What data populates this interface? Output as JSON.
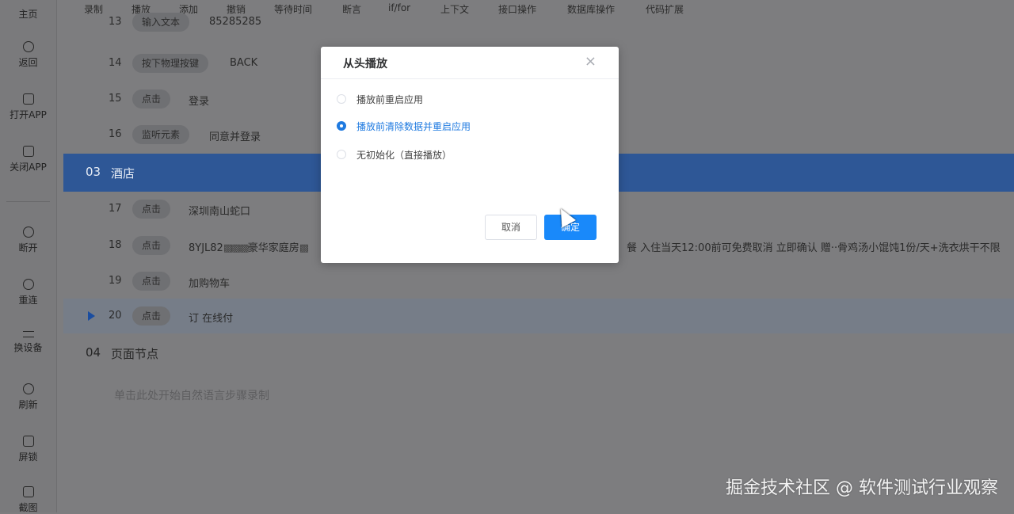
{
  "sidebar": {
    "items": [
      {
        "label": "主页",
        "icon": "home-icon"
      },
      {
        "label": "返回",
        "icon": "back-icon"
      },
      {
        "label": "打开APP",
        "icon": "open-app-icon"
      },
      {
        "label": "关闭APP",
        "icon": "close-app-icon"
      },
      {
        "label": "断开",
        "icon": "disconnect-icon"
      },
      {
        "label": "重连",
        "icon": "link-icon"
      },
      {
        "label": "换设备",
        "icon": "swap-icon"
      },
      {
        "label": "刷新",
        "icon": "refresh-icon"
      },
      {
        "label": "屏锁",
        "icon": "lock-icon"
      },
      {
        "label": "截图",
        "icon": "crop-icon"
      }
    ]
  },
  "toolbar": {
    "items": [
      "录制",
      "播放",
      "添加",
      "撤销",
      "等待时间",
      "断言",
      "if/for",
      "上下文",
      "接口操作",
      "数据库操作",
      "代码扩展"
    ]
  },
  "steps": {
    "row13": {
      "num": "13",
      "tag": "输入文本",
      "value": "85285285"
    },
    "row14": {
      "num": "14",
      "tag": "按下物理按键",
      "value": "BACK"
    },
    "row15": {
      "num": "15",
      "tag": "点击",
      "value": "登录"
    },
    "row16": {
      "num": "16",
      "tag": "监听元素",
      "value": "同意并登录"
    },
    "section03": {
      "num": "03",
      "title": "酒店"
    },
    "row17": {
      "num": "17",
      "tag": "点击",
      "value": "深圳南山蛇口"
    },
    "row18": {
      "num": "18",
      "tag": "点击",
      "value_left": "8YJL82",
      "value_mid": "豪华家庭房",
      "value_right": "餐 入住当天12:00前可免费取消 立即确认 赠··骨鸡汤小馄饨1份/天+洗衣烘干不限"
    },
    "row19": {
      "num": "19",
      "tag": "点击",
      "value": "加购物车"
    },
    "row20": {
      "num": "20",
      "tag": "点击",
      "value": "订 在线付"
    },
    "section04": {
      "num": "04",
      "title": "页面节点"
    },
    "hint": "单击此处开始自然语言步骤录制"
  },
  "dialog": {
    "title": "从头播放",
    "close": "×",
    "options": [
      {
        "label": "播放前重启应用",
        "checked": false
      },
      {
        "label": "播放前清除数据并重启应用",
        "checked": true
      },
      {
        "label": "无初始化（直接播放）",
        "checked": false
      }
    ],
    "cancel": "取消",
    "ok": "确定"
  },
  "watermark": "掘金技术社区 @ 软件测试行业观察",
  "colors": {
    "accent": "#1989fa",
    "section_highlight": "#2e5796",
    "overlay": "#7d7d7f"
  }
}
